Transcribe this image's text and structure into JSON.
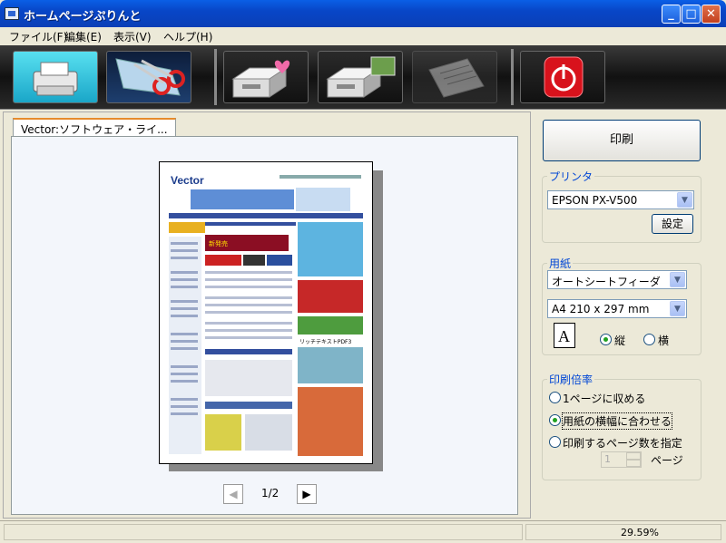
{
  "window": {
    "title": "ホームページぷりんと",
    "buttons": [
      "_",
      "□",
      "✕"
    ]
  },
  "menu": [
    "ファイル(F)",
    "編集(E)",
    "表示(V)",
    "ヘルプ(H)"
  ],
  "toolbar": {
    "items": [
      {
        "name": "print-tool",
        "icon": "printer-icon"
      },
      {
        "name": "clip-tool",
        "icon": "scissors-icon"
      },
      {
        "name": "favorite-tray-tool",
        "icon": "tray-heart-icon"
      },
      {
        "name": "image-tray-tool",
        "icon": "tray-image-icon"
      },
      {
        "name": "document-tool",
        "icon": "document-icon"
      },
      {
        "name": "power-tool",
        "icon": "power-icon"
      }
    ]
  },
  "preview": {
    "tab_label": "Vector:ソフトウェア・ライ...",
    "page_indicator": "1/2",
    "page": {
      "logo": "Vector",
      "banner1": "見たまんまにカンタン印刷！",
      "product": "リッチテキストPDF3"
    }
  },
  "right": {
    "print_button": "印刷",
    "printer_group": "プリンタ",
    "printer_value": "EPSON PX-V500",
    "settings_button": "設定",
    "paper_group": "用紙",
    "paper_source": "オートシートフィーダ",
    "paper_size": "A4 210 x 297 mm",
    "orientation_icon_letter": "A",
    "orientation_portrait": "縦",
    "orientation_landscape": "横",
    "scale_group": "印刷倍率",
    "scale_options": [
      "1ページに収める",
      "用紙の横幅に合わせる",
      "印刷するページ数を指定"
    ],
    "pages_suffix": "ページ",
    "pages_value": "1"
  },
  "status": {
    "zoom": "29.59%"
  }
}
